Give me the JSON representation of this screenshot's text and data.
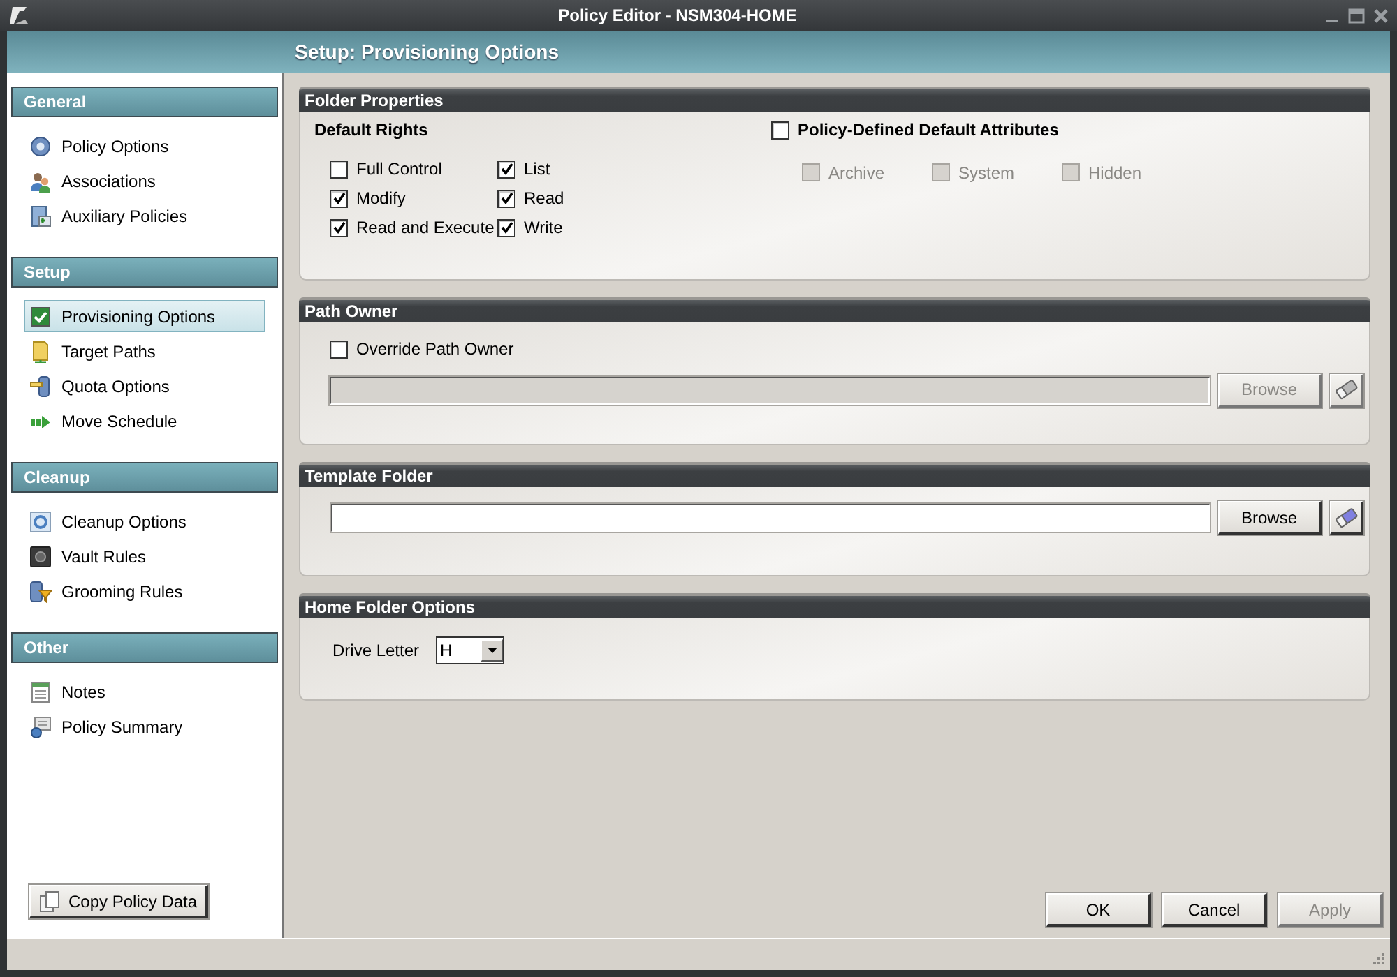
{
  "window": {
    "title": "Policy Editor - NSM304-HOME"
  },
  "header": {
    "title": "Setup: Provisioning Options"
  },
  "sidebar": {
    "sections": [
      {
        "title": "General",
        "items": [
          {
            "label": "Policy Options",
            "selected": false
          },
          {
            "label": "Associations",
            "selected": false
          },
          {
            "label": "Auxiliary Policies",
            "selected": false
          }
        ]
      },
      {
        "title": "Setup",
        "items": [
          {
            "label": "Provisioning Options",
            "selected": true
          },
          {
            "label": "Target Paths",
            "selected": false
          },
          {
            "label": "Quota Options",
            "selected": false
          },
          {
            "label": "Move Schedule",
            "selected": false
          }
        ]
      },
      {
        "title": "Cleanup",
        "items": [
          {
            "label": "Cleanup Options",
            "selected": false
          },
          {
            "label": "Vault Rules",
            "selected": false
          },
          {
            "label": "Grooming Rules",
            "selected": false
          }
        ]
      },
      {
        "title": "Other",
        "items": [
          {
            "label": "Notes",
            "selected": false
          },
          {
            "label": "Policy Summary",
            "selected": false
          }
        ]
      }
    ],
    "copy_button": {
      "label": "Copy Policy Data"
    }
  },
  "folder_properties": {
    "title": "Folder Properties",
    "default_rights": {
      "title": "Default Rights",
      "options": [
        {
          "label": "Full Control",
          "checked": false
        },
        {
          "label": "List",
          "checked": true
        },
        {
          "label": "Modify",
          "checked": true
        },
        {
          "label": "Read",
          "checked": true
        },
        {
          "label": "Read and Execute",
          "checked": true
        },
        {
          "label": "Write",
          "checked": true
        }
      ]
    },
    "attributes": {
      "label": "Policy-Defined Default Attributes",
      "checked": false,
      "options": [
        {
          "label": "Archive",
          "checked": false,
          "disabled": true
        },
        {
          "label": "System",
          "checked": false,
          "disabled": true
        },
        {
          "label": "Hidden",
          "checked": false,
          "disabled": true
        }
      ]
    }
  },
  "path_owner": {
    "title": "Path Owner",
    "override": {
      "label": "Override Path Owner",
      "checked": false
    },
    "field": {
      "disabled": true
    },
    "browse": {
      "label": "Browse",
      "disabled": true
    },
    "clear": {
      "disabled": true
    }
  },
  "template_folder": {
    "title": "Template Folder",
    "field": {
      "disabled": false
    },
    "browse": {
      "label": "Browse",
      "disabled": false
    },
    "clear": {
      "disabled": false
    }
  },
  "home_folder": {
    "title": "Home Folder Options",
    "drive_letter": {
      "label": "Drive Letter",
      "value": "H"
    }
  },
  "buttons": [
    {
      "label": "OK",
      "disabled": false
    },
    {
      "label": "Cancel",
      "disabled": false
    },
    {
      "label": "Apply",
      "disabled": true
    }
  ]
}
